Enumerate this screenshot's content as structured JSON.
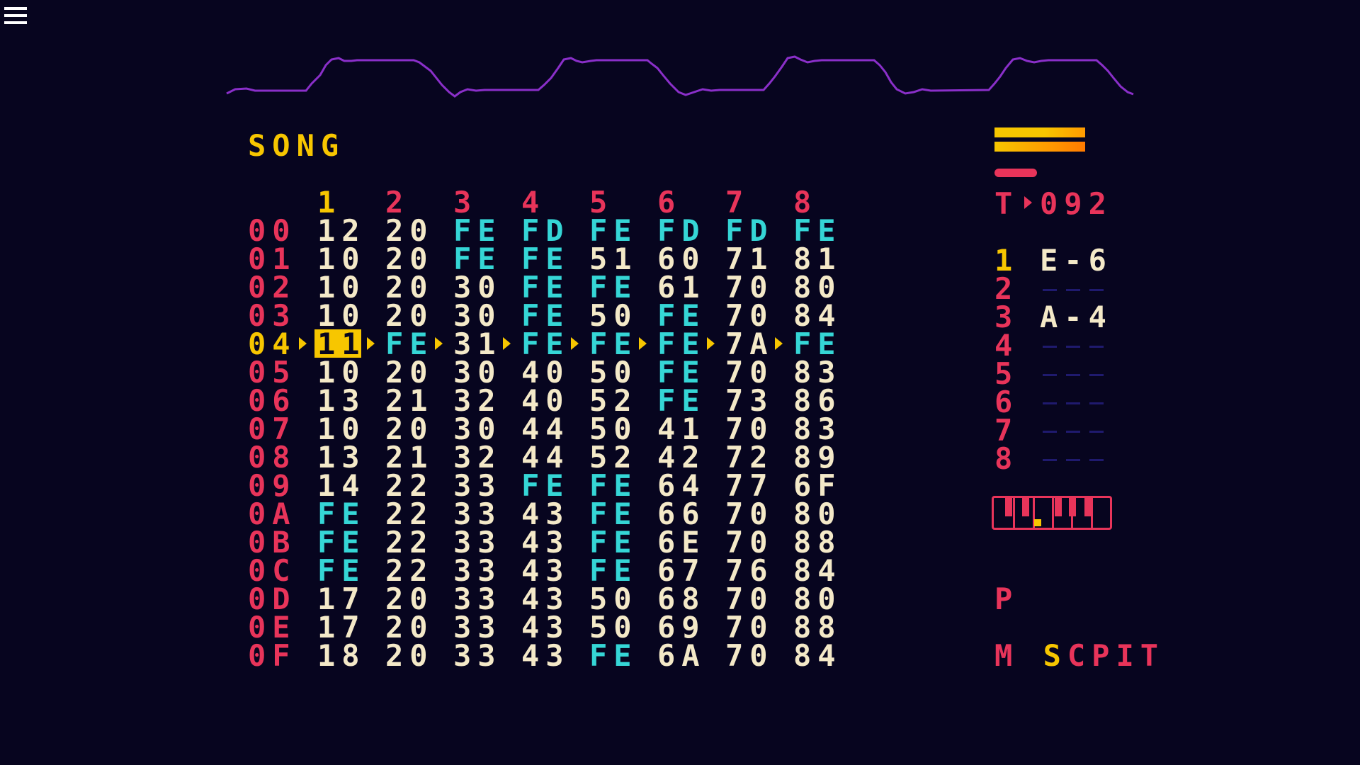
{
  "colors": {
    "background": "#07051f",
    "header_num": "#f7c600",
    "row_label": "#e8345a",
    "value": "#f4e9c8",
    "empty": "#35d6d6",
    "highlight": "#f7c600",
    "wave": "#8a2fc9",
    "dash": "#1f1a6e"
  },
  "menu": {
    "icon": "hamburger-menu-icon"
  },
  "song": {
    "title": "SONG",
    "columns": [
      "1",
      "2",
      "3",
      "4",
      "5",
      "6",
      "7",
      "8"
    ],
    "rows": [
      {
        "label": "00",
        "cells": [
          "12",
          "20",
          "FE",
          "FD",
          "FE",
          "FD",
          "FD",
          "FE"
        ]
      },
      {
        "label": "01",
        "cells": [
          "10",
          "20",
          "FE",
          "FE",
          "51",
          "60",
          "71",
          "81"
        ]
      },
      {
        "label": "02",
        "cells": [
          "10",
          "20",
          "30",
          "FE",
          "FE",
          "61",
          "70",
          "80"
        ]
      },
      {
        "label": "03",
        "cells": [
          "10",
          "20",
          "30",
          "FE",
          "50",
          "FE",
          "70",
          "84"
        ]
      },
      {
        "label": "04",
        "cells": [
          "11",
          "FE",
          "31",
          "FE",
          "FE",
          "FE",
          "7A",
          "FE"
        ]
      },
      {
        "label": "05",
        "cells": [
          "10",
          "20",
          "30",
          "40",
          "50",
          "FE",
          "70",
          "83"
        ]
      },
      {
        "label": "06",
        "cells": [
          "13",
          "21",
          "32",
          "40",
          "52",
          "FE",
          "73",
          "86"
        ]
      },
      {
        "label": "07",
        "cells": [
          "10",
          "20",
          "30",
          "44",
          "50",
          "41",
          "70",
          "83"
        ]
      },
      {
        "label": "08",
        "cells": [
          "13",
          "21",
          "32",
          "44",
          "52",
          "42",
          "72",
          "89"
        ]
      },
      {
        "label": "09",
        "cells": [
          "14",
          "22",
          "33",
          "FE",
          "FE",
          "64",
          "77",
          "6F"
        ]
      },
      {
        "label": "0A",
        "cells": [
          "FE",
          "22",
          "33",
          "43",
          "FE",
          "66",
          "70",
          "80"
        ]
      },
      {
        "label": "0B",
        "cells": [
          "FE",
          "22",
          "33",
          "43",
          "FE",
          "6E",
          "70",
          "88"
        ]
      },
      {
        "label": "0C",
        "cells": [
          "FE",
          "22",
          "33",
          "43",
          "FE",
          "67",
          "76",
          "84"
        ]
      },
      {
        "label": "0D",
        "cells": [
          "17",
          "20",
          "33",
          "43",
          "50",
          "68",
          "70",
          "80"
        ]
      },
      {
        "label": "0E",
        "cells": [
          "17",
          "20",
          "33",
          "43",
          "50",
          "69",
          "70",
          "88"
        ]
      },
      {
        "label": "0F",
        "cells": [
          "18",
          "20",
          "33",
          "43",
          "FE",
          "6A",
          "70",
          "84"
        ]
      }
    ],
    "cursor_row": 4,
    "cursor_col": 0
  },
  "side": {
    "tempo_label": "T",
    "tempo_value": "092",
    "channels": [
      {
        "num": "1",
        "note": "E-6"
      },
      {
        "num": "2",
        "note": ""
      },
      {
        "num": "3",
        "note": "A-4"
      },
      {
        "num": "4",
        "note": ""
      },
      {
        "num": "5",
        "note": ""
      },
      {
        "num": "6",
        "note": ""
      },
      {
        "num": "7",
        "note": ""
      },
      {
        "num": "8",
        "note": ""
      }
    ],
    "piano_icon": "piano-keyboard-icon",
    "modes": {
      "top": "P",
      "middle": "SCPIT",
      "bottom": "M"
    }
  }
}
